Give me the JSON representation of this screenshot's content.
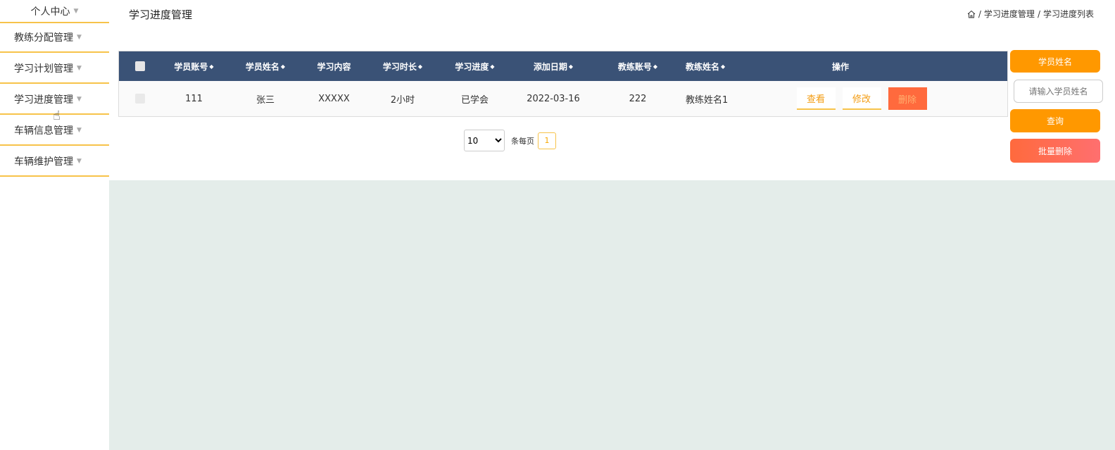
{
  "sidebar": {
    "items": [
      {
        "label": "个人中心"
      },
      {
        "label": "教练分配管理"
      },
      {
        "label": "学习计划管理"
      },
      {
        "label": "学习进度管理"
      },
      {
        "label": "车辆信息管理"
      },
      {
        "label": "车辆维护管理"
      }
    ]
  },
  "header": {
    "title": "学习进度管理",
    "breadcrumb": [
      "学习进度管理",
      "学习进度列表"
    ],
    "separator": "/"
  },
  "table": {
    "columns": [
      "学员账号",
      "学员姓名",
      "学习内容",
      "学习时长",
      "学习进度",
      "添加日期",
      "教练账号",
      "教练姓名",
      "操作"
    ],
    "rows": [
      {
        "student_account": "111",
        "student_name": "张三",
        "content": "XXXXX",
        "duration": "2小时",
        "progress": "已学会",
        "date": "2022-03-16",
        "coach_account": "222",
        "coach_name": "教练姓名1"
      }
    ],
    "actions": {
      "view": "查看",
      "edit": "修改",
      "delete": "删除"
    }
  },
  "pagination": {
    "page_size": "10",
    "page_size_options": [
      "10"
    ],
    "per_page_label": "条每页",
    "current_page": "1"
  },
  "search": {
    "label": "学员姓名",
    "placeholder": "请输入学员姓名",
    "search_button": "查询",
    "batch_delete_button": "批量删除"
  },
  "colors": {
    "accent": "#ff9800",
    "table_header": "#3a5276",
    "danger": "#ff6a3d",
    "sidebar_border": "#f7c34a",
    "content_bg": "#e4edea"
  }
}
